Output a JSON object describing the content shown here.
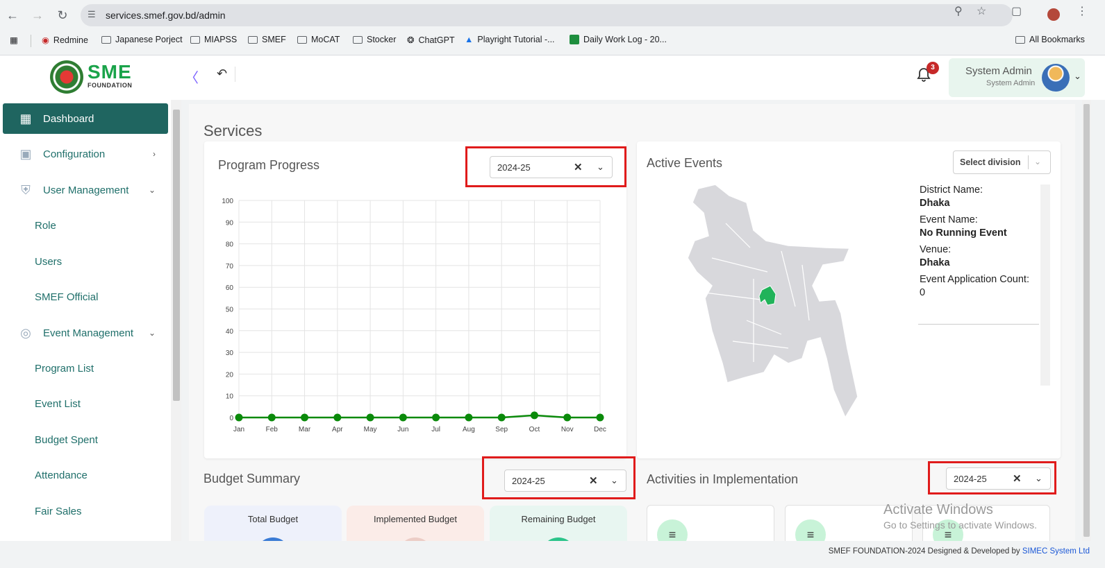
{
  "browser": {
    "url": "services.smef.gov.bd/admin",
    "bookmarks": [
      "Redmine",
      "Japanese Porject",
      "MIAPSS",
      "SMEF",
      "MoCAT",
      "Stocker",
      "ChatGPT",
      "Playright Tutorial -...",
      "Daily Work Log - 20..."
    ],
    "all_bookmarks": "All Bookmarks"
  },
  "header": {
    "logo_text": "SME",
    "logo_sub": "FOUNDATION",
    "notification_count": "3",
    "user_name": "System Admin",
    "user_role": "System Admin"
  },
  "sidebar": {
    "dashboard": "Dashboard",
    "configuration": "Configuration",
    "user_management": "User Management",
    "role": "Role",
    "users": "Users",
    "smef_official": "SMEF Official",
    "event_management": "Event Management",
    "program_list": "Program List",
    "event_list": "Event List",
    "budget_spent": "Budget Spent",
    "attendance": "Attendance",
    "fair_sales": "Fair Sales"
  },
  "main": {
    "page_title": "Services",
    "program_progress": {
      "title": "Program Progress",
      "year": "2024-25"
    },
    "active_events": {
      "title": "Active Events",
      "division_placeholder": "Select division",
      "district_label": "District Name:",
      "district_value": "Dhaka",
      "event_label": "Event Name:",
      "event_value": "No Running Event",
      "venue_label": "Venue:",
      "venue_value": "Dhaka",
      "count_label": "Event Application Count:",
      "count_value": "0"
    },
    "budget_summary": {
      "title": "Budget Summary",
      "year": "2024-25",
      "total": "Total Budget",
      "implemented": "Implemented Budget",
      "remaining": "Remaining Budget"
    },
    "activities": {
      "title": "Activities in Implementation",
      "year": "2024-25"
    }
  },
  "chart_data": {
    "type": "line",
    "categories": [
      "Jan",
      "Feb",
      "Mar",
      "Apr",
      "May",
      "Jun",
      "Jul",
      "Aug",
      "Sep",
      "Oct",
      "Nov",
      "Dec"
    ],
    "values": [
      0,
      0,
      0,
      0,
      0,
      0,
      0,
      0,
      0,
      1,
      0,
      0
    ],
    "ylim": [
      0,
      100
    ],
    "yticks": [
      0,
      10,
      20,
      30,
      40,
      50,
      60,
      70,
      80,
      90,
      100
    ],
    "grid": true,
    "color": "#0a8a0a"
  },
  "watermark": {
    "line1": "Activate Windows",
    "line2": "Go to Settings to activate Windows."
  },
  "footer": {
    "text": "SMEF FOUNDATION-2024   Designed & Developed by ",
    "link": "SIMEC System Ltd"
  },
  "colors": {
    "accent": "#1f6560",
    "highlight_box": "#e01b1b",
    "map_highlight": "#21b35a"
  }
}
